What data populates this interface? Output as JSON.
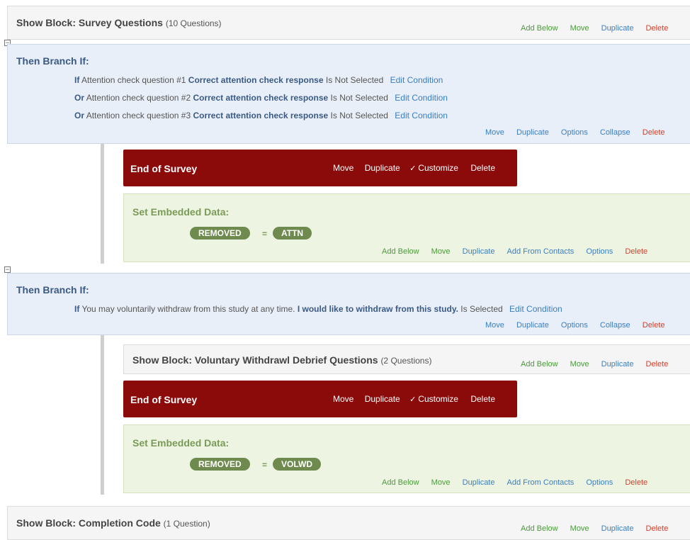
{
  "actions": {
    "add_below": "Add Below",
    "move": "Move",
    "duplicate": "Duplicate",
    "delete": "Delete",
    "options": "Options",
    "collapse": "Collapse",
    "customize": "Customize",
    "add_from_contacts": "Add From Contacts",
    "edit_condition": "Edit Condition"
  },
  "block1": {
    "label": "Show Block: Survey Questions",
    "count": "(10 Questions)"
  },
  "branch1": {
    "title": "Then Branch If:",
    "conditions": [
      {
        "keyword": "If",
        "question": "Attention check question #1",
        "answer": "Correct attention check response",
        "operator": "Is Not Selected"
      },
      {
        "keyword": "Or",
        "question": "Attention check question #2",
        "answer": "Correct attention check response",
        "operator": "Is Not Selected"
      },
      {
        "keyword": "Or",
        "question": "Attention check question #3",
        "answer": "Correct attention check response",
        "operator": "Is Not Selected"
      }
    ]
  },
  "end_of_survey": {
    "title": "End of Survey"
  },
  "embedded1": {
    "title": "Set Embedded Data:",
    "field": "REMOVED",
    "eq": "=",
    "value": "ATTN"
  },
  "branch2": {
    "title": "Then Branch If:",
    "conditions": [
      {
        "keyword": "If",
        "question": "You may voluntarily withdraw from this study at any time.",
        "answer": "I would like to withdraw from this study.",
        "operator": "Is Selected"
      }
    ]
  },
  "block2": {
    "label": "Show Block: Voluntary Withdrawl Debrief Questions",
    "count": "(2 Questions)"
  },
  "embedded2": {
    "title": "Set Embedded Data:",
    "field": "REMOVED",
    "eq": "=",
    "value": "VOLWD"
  },
  "block3": {
    "label": "Show Block: Completion Code",
    "count": "(1 Question)"
  },
  "icons": {
    "collapse": "collapse-minus-icon",
    "check": "check-icon"
  },
  "colors": {
    "end_of_survey": "#8b0a0a",
    "branch_bg": "#e9eff8",
    "embedded_bg": "#eef4e2",
    "block_bg": "#f5f5f5"
  }
}
